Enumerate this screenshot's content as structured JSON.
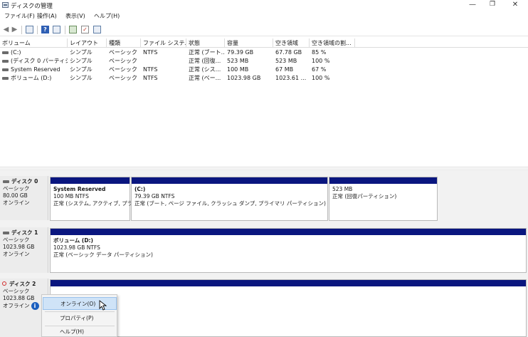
{
  "window": {
    "title": "ディスクの管理",
    "min_glyph": "—",
    "max_glyph": "❐",
    "close_glyph": "✕"
  },
  "menu": [
    "ファイル(F)",
    "操作(A)",
    "表示(V)",
    "ヘルプ(H)"
  ],
  "toolbar": {
    "icons": [
      "back-icon",
      "forward-icon",
      "list-view-icon",
      "help-icon",
      "properties-icon",
      "connect-icon",
      "check-icon",
      "disk-view-icon"
    ],
    "help_glyph": "?",
    "check_glyph": "✓"
  },
  "volume_table": {
    "columns": [
      "ボリューム",
      "レイアウト",
      "種類",
      "ファイル システム",
      "状態",
      "容量",
      "空き領域",
      "空き領域の割..."
    ],
    "rows": [
      [
        "(C:)",
        "シンプル",
        "ベーシック",
        "NTFS",
        "正常 (ブート...",
        "79.39 GB",
        "67.78 GB",
        "85 %"
      ],
      [
        "(ディスク 0 パーティシ...",
        "シンプル",
        "ベーシック",
        "",
        "正常 (回復...",
        "523 MB",
        "523 MB",
        "100 %"
      ],
      [
        "System Reserved",
        "シンプル",
        "ベーシック",
        "NTFS",
        "正常 (シス...",
        "100 MB",
        "67 MB",
        "67 %"
      ],
      [
        "ボリューム (D:)",
        "シンプル",
        "ベーシック",
        "NTFS",
        "正常 (ベー...",
        "1023.98 GB",
        "1023.61 ...",
        "100 %"
      ]
    ]
  },
  "disks": [
    {
      "name": "ディスク 0",
      "type": "ベーシック",
      "size": "80.00 GB",
      "status": "オンライン",
      "partitions": [
        {
          "name": "System Reserved",
          "size": "100 MB NTFS",
          "status": "正常 (システム, アクティブ, プラ"
        },
        {
          "name": "(C:)",
          "size": "79.39 GB NTFS",
          "status": "正常 (ブート, ページ ファイル, クラッシュ ダンプ, プライマリ パーティション)"
        },
        {
          "name": "",
          "size": "523 MB",
          "status": "正常 (回復パーティション)"
        }
      ]
    },
    {
      "name": "ディスク 1",
      "type": "ベーシック",
      "size": "1023.98 GB",
      "status": "オンライン",
      "partitions": [
        {
          "name": "ボリューム (D:)",
          "size": "1023.98 GB NTFS",
          "status": "正常 (ベーシック データ パーティション)"
        }
      ]
    },
    {
      "name": "ディスク 2",
      "type": "ベーシック",
      "size": "1023.88 GB",
      "status": "オフライン",
      "info_glyph": "i"
    }
  ],
  "context_menu": {
    "items": [
      "オンライン(O)",
      "プロパティ(P)",
      "ヘルプ(H)"
    ],
    "highlighted": "オンライン(O)"
  }
}
